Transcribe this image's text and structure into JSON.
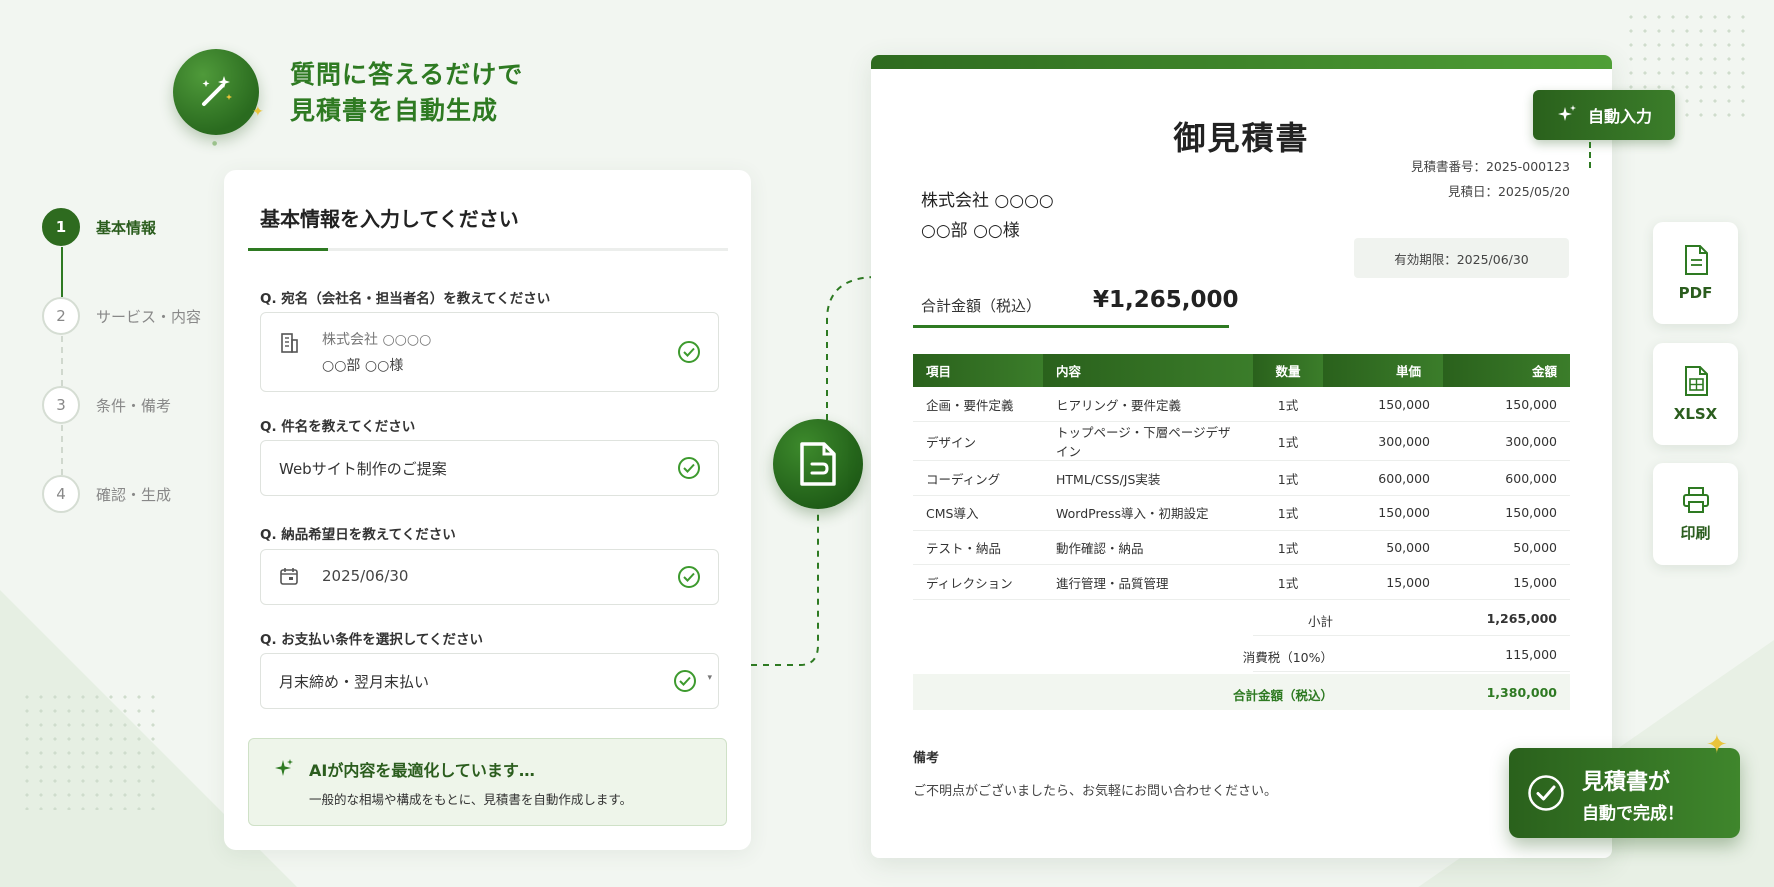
{
  "hero": {
    "line1": "質問に答えるだけで",
    "line2": "見積書を自動生成"
  },
  "steps": [
    {
      "number": "1",
      "label": "基本情報",
      "active": true
    },
    {
      "number": "2",
      "label": "サービス・内容",
      "active": false
    },
    {
      "number": "3",
      "label": "条件・備考",
      "active": false
    },
    {
      "number": "4",
      "label": "確認・生成",
      "active": false
    }
  ],
  "form": {
    "title": "基本情報を入力してください",
    "q1": {
      "label": "Q. 宛名（会社名・担当者名）を教えてください",
      "line1": "株式会社 ○○○○",
      "line2": "○○部 ○○様"
    },
    "q2": {
      "label": "Q. 件名を教えてください",
      "value": "Webサイト制作のご提案"
    },
    "q3": {
      "label": "Q. 納品希望日を教えてください",
      "value": "2025/06/30"
    },
    "q4": {
      "label": "Q. お支払い条件を選択してください",
      "value": "月末締め・翌月末払い"
    },
    "ai": {
      "title": "AIが内容を最適化しています…",
      "desc": "一般的な相場や構成をもとに、見積書を自動作成します。"
    }
  },
  "estimate": {
    "title": "御見積書",
    "number": "見積書番号：2025-000123",
    "date": "見積日：2025/05/20",
    "client_company": "株式会社 ○○○○",
    "client_person": "○○部 ○○様",
    "validity": "有効期限：2025/06/30",
    "total_label": "合計金額（税込）",
    "total_value": "¥1,265,000",
    "columns": [
      "項目",
      "内容",
      "数量",
      "単価",
      "金額"
    ],
    "rows": [
      [
        "企画・要件定義",
        "ヒアリング・要件定義",
        "1式",
        "150,000",
        "150,000"
      ],
      [
        "デザイン",
        "トップページ・下層ページデザイン",
        "1式",
        "300,000",
        "300,000"
      ],
      [
        "コーディング",
        "HTML/CSS/JS実装",
        "1式",
        "600,000",
        "600,000"
      ],
      [
        "CMS導入",
        "WordPress導入・初期設定",
        "1式",
        "150,000",
        "150,000"
      ],
      [
        "テスト・納品",
        "動作確認・納品",
        "1式",
        "50,000",
        "50,000"
      ],
      [
        "ディレクション",
        "進行管理・品質管理",
        "1式",
        "15,000",
        "15,000"
      ]
    ],
    "subtotal_label": "小計",
    "subtotal_value": "1,265,000",
    "tax_label": "消費税（10%）",
    "tax_value": "115,000",
    "grand_label": "合計金額（税込）",
    "grand_value": "1,380,000",
    "notes_title": "備考",
    "notes_text": "ご不明点がございましたら、お気軽にお問い合わせください。"
  },
  "auto_badge": "自動入力",
  "exports": {
    "pdf": "PDF",
    "xlsx": "XLSX",
    "print": "印刷"
  },
  "done": {
    "line1": "見積書が",
    "line2": "自動で完成！"
  },
  "colors": {
    "primary": "#2e7a22",
    "dark": "#2a611c",
    "accent_gold": "#e9c43b"
  }
}
